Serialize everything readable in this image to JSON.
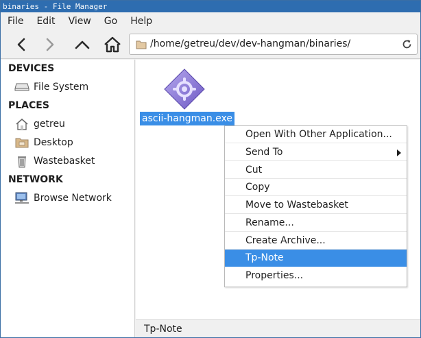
{
  "window": {
    "title": "binaries - File Manager"
  },
  "menubar": {
    "items": [
      "File",
      "Edit",
      "View",
      "Go",
      "Help"
    ]
  },
  "toolbar": {
    "back_icon": "chevron-left-icon",
    "forward_icon": "chevron-right-icon",
    "up_icon": "chevron-up-icon",
    "home_icon": "home-icon",
    "location_path": "/home/getreu/dev/dev-hangman/binaries/",
    "reload_icon": "reload-icon"
  },
  "sidebar": {
    "sections": [
      {
        "heading": "DEVICES",
        "items": [
          {
            "label": "File System",
            "icon": "drive-icon"
          }
        ]
      },
      {
        "heading": "PLACES",
        "items": [
          {
            "label": "getreu",
            "icon": "home-folder-icon"
          },
          {
            "label": "Desktop",
            "icon": "desktop-folder-icon"
          },
          {
            "label": "Wastebasket",
            "icon": "trash-icon"
          }
        ]
      },
      {
        "heading": "NETWORK",
        "items": [
          {
            "label": "Browse Network",
            "icon": "network-icon"
          }
        ]
      }
    ]
  },
  "content": {
    "files": [
      {
        "name": "ascii-hangman.exe",
        "icon": "executable-icon",
        "selected": true
      }
    ]
  },
  "context_menu": {
    "items": [
      {
        "label": "Open With Other Application..."
      },
      {
        "label": "Send To",
        "submenu": true
      },
      {
        "label": "Cut"
      },
      {
        "label": "Copy"
      },
      {
        "label": "Move to Wastebasket"
      },
      {
        "label": "Rename..."
      },
      {
        "label": "Create Archive..."
      },
      {
        "label": "Tp-Note",
        "highlighted": true
      },
      {
        "label": "Properties..."
      }
    ]
  },
  "statusbar": {
    "text": "Tp-Note"
  },
  "colors": {
    "selection": "#3a8ee6",
    "titlebar": "#2e6db0",
    "icon_purple": "#8b77d6"
  }
}
